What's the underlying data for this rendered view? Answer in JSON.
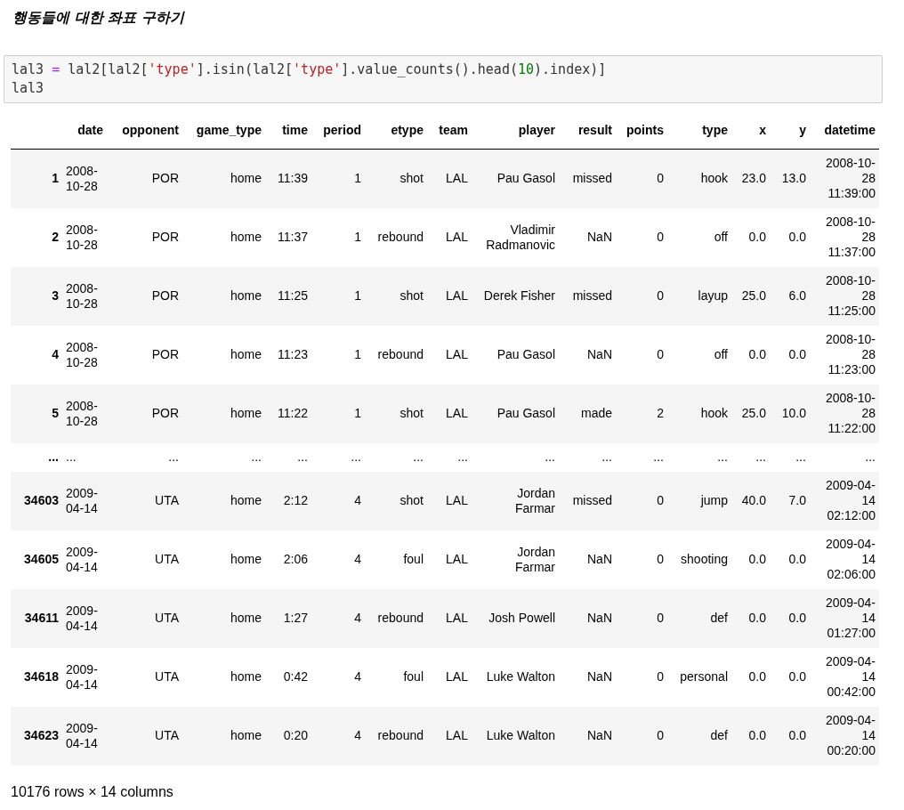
{
  "heading": "행동들에 대한 좌표 구하기",
  "code_cell": {
    "lines": [
      [
        {
          "text": "lal3 ",
          "kind": "plain"
        },
        {
          "text": "=",
          "kind": "op"
        },
        {
          "text": " lal2[lal2[",
          "kind": "plain"
        },
        {
          "text": "'type'",
          "kind": "string"
        },
        {
          "text": "].isin(lal2[",
          "kind": "plain"
        },
        {
          "text": "'type'",
          "kind": "string"
        },
        {
          "text": "].value_counts().head(",
          "kind": "plain"
        },
        {
          "text": "10",
          "kind": "number"
        },
        {
          "text": ").index)]",
          "kind": "plain"
        }
      ],
      [
        {
          "text": "lal3",
          "kind": "plain"
        }
      ]
    ]
  },
  "table": {
    "columns": [
      "date",
      "opponent",
      "game_type",
      "time",
      "period",
      "etype",
      "team",
      "player",
      "result",
      "points",
      "type",
      "x",
      "y",
      "datetime"
    ],
    "rows": [
      {
        "index": "1",
        "cells": [
          "2008-10-28",
          "POR",
          "home",
          "11:39",
          "1",
          "shot",
          "LAL",
          "Pau Gasol",
          "missed",
          "0",
          "hook",
          "23.0",
          "13.0",
          "2008-10-28 11:39:00"
        ]
      },
      {
        "index": "2",
        "cells": [
          "2008-10-28",
          "POR",
          "home",
          "11:37",
          "1",
          "rebound",
          "LAL",
          "Vladimir Radmanovic",
          "NaN",
          "0",
          "off",
          "0.0",
          "0.0",
          "2008-10-28 11:37:00"
        ]
      },
      {
        "index": "3",
        "cells": [
          "2008-10-28",
          "POR",
          "home",
          "11:25",
          "1",
          "shot",
          "LAL",
          "Derek Fisher",
          "missed",
          "0",
          "layup",
          "25.0",
          "6.0",
          "2008-10-28 11:25:00"
        ]
      },
      {
        "index": "4",
        "cells": [
          "2008-10-28",
          "POR",
          "home",
          "11:23",
          "1",
          "rebound",
          "LAL",
          "Pau Gasol",
          "NaN",
          "0",
          "off",
          "0.0",
          "0.0",
          "2008-10-28 11:23:00"
        ]
      },
      {
        "index": "5",
        "cells": [
          "2008-10-28",
          "POR",
          "home",
          "11:22",
          "1",
          "shot",
          "LAL",
          "Pau Gasol",
          "made",
          "2",
          "hook",
          "25.0",
          "10.0",
          "2008-10-28 11:22:00"
        ]
      },
      {
        "index": "...",
        "cells": [
          "...",
          "...",
          "...",
          "...",
          "...",
          "...",
          "...",
          "...",
          "...",
          "...",
          "...",
          "...",
          "...",
          "..."
        ]
      },
      {
        "index": "34603",
        "cells": [
          "2009-04-14",
          "UTA",
          "home",
          "2:12",
          "4",
          "shot",
          "LAL",
          "Jordan Farmar",
          "missed",
          "0",
          "jump",
          "40.0",
          "7.0",
          "2009-04-14 02:12:00"
        ]
      },
      {
        "index": "34605",
        "cells": [
          "2009-04-14",
          "UTA",
          "home",
          "2:06",
          "4",
          "foul",
          "LAL",
          "Jordan Farmar",
          "NaN",
          "0",
          "shooting",
          "0.0",
          "0.0",
          "2009-04-14 02:06:00"
        ]
      },
      {
        "index": "34611",
        "cells": [
          "2009-04-14",
          "UTA",
          "home",
          "1:27",
          "4",
          "rebound",
          "LAL",
          "Josh Powell",
          "NaN",
          "0",
          "def",
          "0.0",
          "0.0",
          "2009-04-14 01:27:00"
        ]
      },
      {
        "index": "34618",
        "cells": [
          "2009-04-14",
          "UTA",
          "home",
          "0:42",
          "4",
          "foul",
          "LAL",
          "Luke Walton",
          "NaN",
          "0",
          "personal",
          "0.0",
          "0.0",
          "2009-04-14 00:42:00"
        ]
      },
      {
        "index": "34623",
        "cells": [
          "2009-04-14",
          "UTA",
          "home",
          "0:20",
          "4",
          "rebound",
          "LAL",
          "Luke Walton",
          "NaN",
          "0",
          "def",
          "0.0",
          "0.0",
          "2009-04-14 00:20:00"
        ]
      }
    ]
  },
  "footer": "10176 rows × 14 columns"
}
